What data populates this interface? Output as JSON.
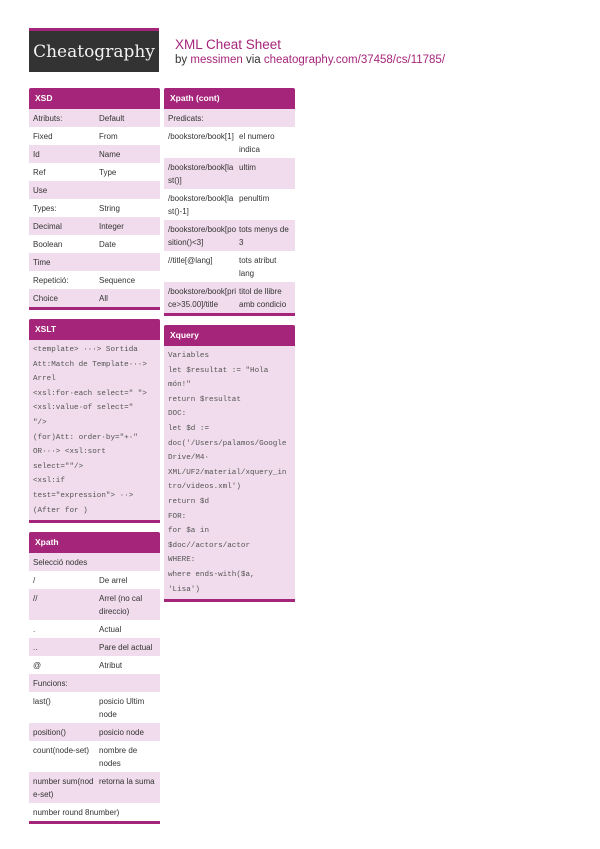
{
  "header": {
    "logo_text": "Cheatography",
    "title": "XML Cheat Sheet",
    "by": "by",
    "author": "messimen",
    "via": "via",
    "url": "cheatography.com/37458/cs/11785/"
  },
  "colors": {
    "accent": "#a5257a",
    "shade": "#f0dcec",
    "logo_bg": "#333333"
  },
  "sections": {
    "xsd": {
      "title": "XSD",
      "rows": [
        {
          "k": "Atributs:",
          "v": "Default"
        },
        {
          "k": "Fixed",
          "v": "From"
        },
        {
          "k": "Id",
          "v": "Name"
        },
        {
          "k": "Ref",
          "v": "Type"
        },
        {
          "k": "Use",
          "v": ""
        },
        {
          "k": "Types:",
          "v": "String"
        },
        {
          "k": "Decimal",
          "v": "Integer"
        },
        {
          "k": "Boolean",
          "v": "Date"
        },
        {
          "k": "Time",
          "v": ""
        },
        {
          "k": "Repetició:",
          "v": "Sequence"
        },
        {
          "k": "Choice",
          "v": "All"
        }
      ]
    },
    "xslt": {
      "title": "XSLT",
      "lines": [
        "<template> ···> Sortida",
        "Att:Match de Template···>",
        "Arrel",
        "<xsl:for·each select=\" \">",
        "<xsl:value·of select=\"",
        "\"/>",
        "(for)Att: order·by=\"+·\"",
        "OR···> <xsl:sort",
        "select=\"\"/>",
        "<xsl:if",
        "test=\"expression\"> ··>",
        "(After for )"
      ]
    },
    "xpath": {
      "title": "Xpath",
      "rows": [
        {
          "k": "Selecció nodes",
          "v": "",
          "full": true
        },
        {
          "k": "/",
          "v": "De arrel"
        },
        {
          "k": "//",
          "v": "Arrel (no cal direccio)"
        },
        {
          "k": ".",
          "v": "Actual"
        },
        {
          "k": "..",
          "v": "Pare del actual"
        },
        {
          "k": "@",
          "v": "Atribut"
        },
        {
          "k": "Funcions:",
          "v": "",
          "full": true
        },
        {
          "k": "last()",
          "v": "posicio Ultim node"
        },
        {
          "k": "position()",
          "v": "posicio node"
        },
        {
          "k": "count(node-set)",
          "v": "nombre de nodes"
        },
        {
          "k": "number sum(node-set)",
          "v": "retorna la suma"
        },
        {
          "k": "number round 8number)",
          "v": "",
          "full": true
        }
      ]
    },
    "xpath_cont": {
      "title": "Xpath (cont)",
      "rows": [
        {
          "k": "Predicats:",
          "v": "",
          "full": true
        },
        {
          "k": "/bookstore/book[1]",
          "v": "el numero indica"
        },
        {
          "k": "/bookstore/book[last()]",
          "v": "ultim"
        },
        {
          "k": "/bookstore/book[last()-1]",
          "v": "penultim"
        },
        {
          "k": "/bookstore/book[position()<3]",
          "v": "tots menys de 3"
        },
        {
          "k": "//title[@lang]",
          "v": "tots atribut lang"
        },
        {
          "k": "/bookstore/book[price>35.00]/title",
          "v": "titol de llibre amb condicio"
        }
      ]
    },
    "xquery": {
      "title": "Xquery",
      "lines": [
        "Variables",
        "let $resultat := \"Hola",
        "món!\"",
        "return $resultat",
        "DOC:",
        "let $d :=",
        "doc('/Users/palamos/Google",
        "Drive/M4·",
        "XML/UF2/material/xquery_in",
        "tro/videos.xml')",
        "return $d",
        "FOR:",
        "for $a in",
        "$doc//actors/actor",
        "WHERE:",
        "where ends-with($a,",
        "'Lisa')"
      ]
    }
  }
}
